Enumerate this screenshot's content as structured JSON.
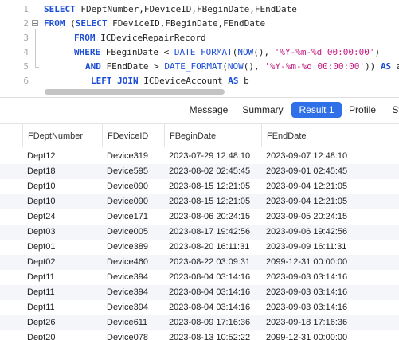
{
  "editor": {
    "lines": [
      {
        "num": "1",
        "tokens": [
          {
            "t": "SELECT ",
            "c": "kw"
          },
          {
            "t": "FDeptNumber,FDeviceID,FBeginDate,FEndDate",
            "c": "id"
          }
        ]
      },
      {
        "num": "2",
        "tokens": [
          {
            "t": "FROM ",
            "c": "kw"
          },
          {
            "t": "(",
            "c": "id"
          },
          {
            "t": "SELECT ",
            "c": "kw"
          },
          {
            "t": "FDeviceID,FBeginDate,FEndDate",
            "c": "id"
          }
        ]
      },
      {
        "num": "3",
        "tokens": [
          {
            "t": "FROM ",
            "c": "kw"
          },
          {
            "t": "ICDeviceRepairRecord",
            "c": "id"
          }
        ]
      },
      {
        "num": "4",
        "tokens": [
          {
            "t": "WHERE ",
            "c": "kw"
          },
          {
            "t": "FBeginDate < ",
            "c": "id"
          },
          {
            "t": "DATE_FORMAT",
            "c": "fn"
          },
          {
            "t": "(",
            "c": "id"
          },
          {
            "t": "NOW",
            "c": "fn"
          },
          {
            "t": "(), ",
            "c": "id"
          },
          {
            "t": "'%Y-%m-%d 00:00:00'",
            "c": "str"
          },
          {
            "t": ")",
            "c": "id"
          }
        ]
      },
      {
        "num": "5",
        "tokens": [
          {
            "t": "AND ",
            "c": "kw"
          },
          {
            "t": "FEndDate > ",
            "c": "id"
          },
          {
            "t": "DATE_FORMAT",
            "c": "fn"
          },
          {
            "t": "(",
            "c": "id"
          },
          {
            "t": "NOW",
            "c": "fn"
          },
          {
            "t": "(), ",
            "c": "id"
          },
          {
            "t": "'%Y-%m-%d 00:00:00'",
            "c": "str"
          },
          {
            "t": ")) ",
            "c": "id"
          },
          {
            "t": "AS ",
            "c": "kw"
          },
          {
            "t": "a",
            "c": "id"
          }
        ]
      },
      {
        "num": "6",
        "tokens": [
          {
            "t": "LEFT JOIN ",
            "c": "kw"
          },
          {
            "t": "ICDeviceAccount ",
            "c": "id"
          },
          {
            "t": "AS ",
            "c": "kw"
          },
          {
            "t": "b",
            "c": "id"
          }
        ]
      }
    ]
  },
  "tabs": [
    {
      "label": "Message",
      "active": false
    },
    {
      "label": "Summary",
      "active": false
    },
    {
      "label": "Result 1",
      "active": true
    },
    {
      "label": "Profile",
      "active": false
    },
    {
      "label": "St",
      "active": false
    }
  ],
  "grid": {
    "columns": [
      "FDeptNumber",
      "FDeviceID",
      "FBeginDate",
      "FEndDate"
    ],
    "rows": [
      [
        "Dept12",
        "Device319",
        "2023-07-29 12:48:10",
        "2023-09-07 12:48:10"
      ],
      [
        "Dept18",
        "Device595",
        "2023-08-02 02:45:45",
        "2023-09-01 02:45:45"
      ],
      [
        "Dept10",
        "Device090",
        "2023-08-15 12:21:05",
        "2023-09-04 12:21:05"
      ],
      [
        "Dept10",
        "Device090",
        "2023-08-15 12:21:05",
        "2023-09-04 12:21:05"
      ],
      [
        "Dept24",
        "Device171",
        "2023-08-06 20:24:15",
        "2023-09-05 20:24:15"
      ],
      [
        "Dept03",
        "Device005",
        "2023-08-17 19:42:56",
        "2023-09-06 19:42:56"
      ],
      [
        "Dept01",
        "Device389",
        "2023-08-20 16:11:31",
        "2023-09-09 16:11:31"
      ],
      [
        "Dept02",
        "Device460",
        "2023-08-22 03:09:31",
        "2099-12-31 00:00:00"
      ],
      [
        "Dept11",
        "Device394",
        "2023-08-04 03:14:16",
        "2023-09-03 03:14:16"
      ],
      [
        "Dept11",
        "Device394",
        "2023-08-04 03:14:16",
        "2023-09-03 03:14:16"
      ],
      [
        "Dept11",
        "Device394",
        "2023-08-04 03:14:16",
        "2023-09-03 03:14:16"
      ],
      [
        "Dept26",
        "Device611",
        "2023-08-09 17:16:36",
        "2023-09-18 17:16:36"
      ],
      [
        "Dept20",
        "Device078",
        "2023-08-13 10:52:22",
        "2099-12-31 00:00:00"
      ]
    ]
  }
}
